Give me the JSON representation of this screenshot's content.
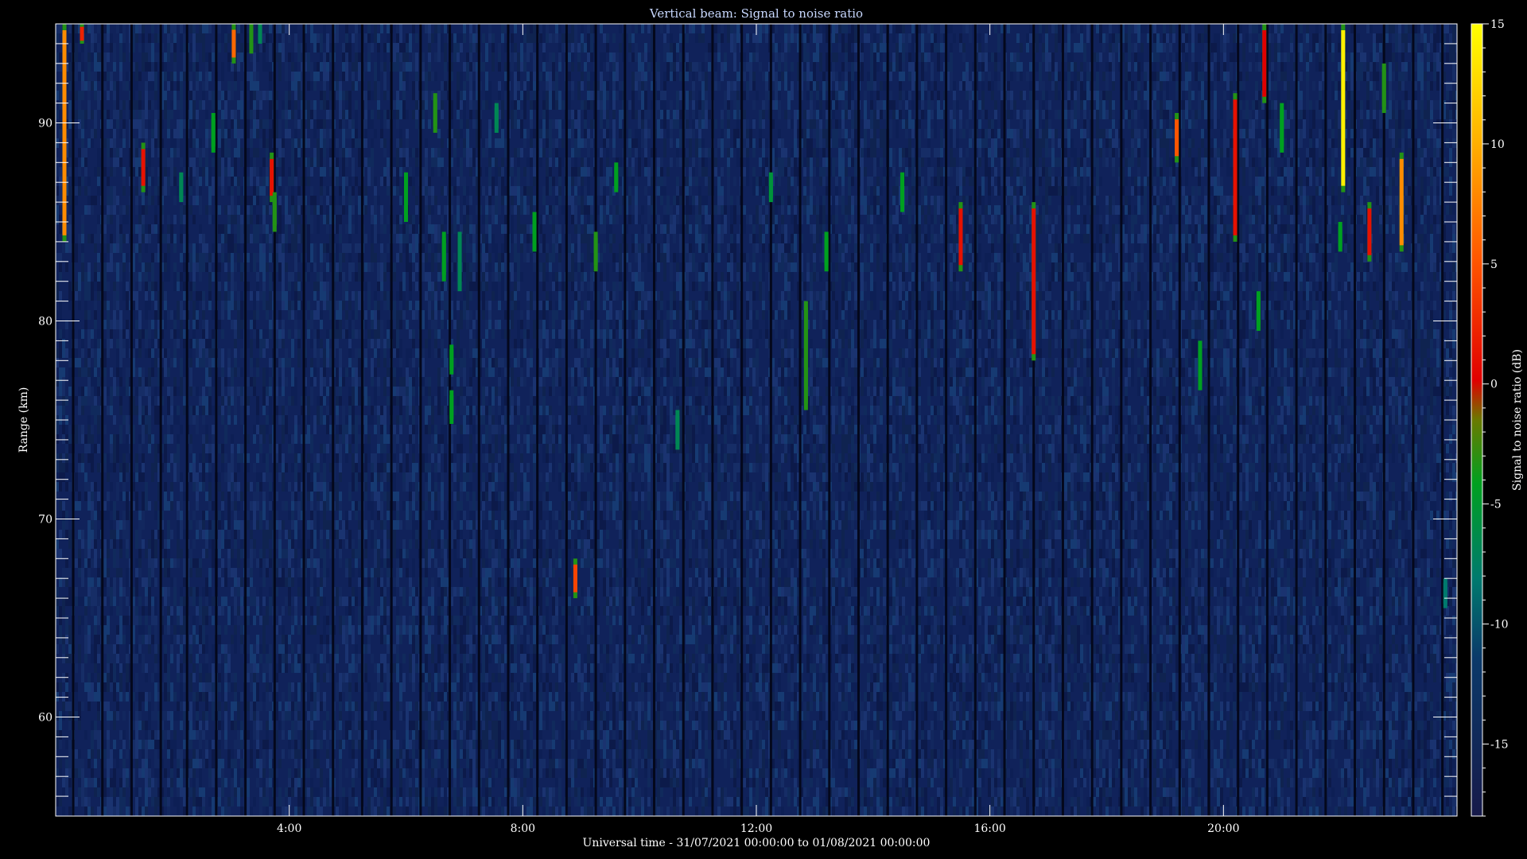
{
  "chart_data": {
    "type": "heatmap",
    "title": "Vertical beam: Signal to noise ratio",
    "xlabel": "Universal time - 31/07/2021 00:00:00 to 01/08/2021 00:00:00",
    "ylabel": "Range (km)",
    "colorbar_label": "Signal to noise ratio (dB)",
    "x_range_hours": [
      0,
      24
    ],
    "y_range_km": [
      55,
      95
    ],
    "color_range_db": [
      -18,
      15
    ],
    "x_ticks": [
      {
        "value": 4,
        "label": "4:00"
      },
      {
        "value": 8,
        "label": "8:00"
      },
      {
        "value": 12,
        "label": "12:00"
      },
      {
        "value": 16,
        "label": "16:00"
      },
      {
        "value": 20,
        "label": "20:00"
      }
    ],
    "y_ticks": [
      {
        "value": 60,
        "label": "60"
      },
      {
        "value": 70,
        "label": "70"
      },
      {
        "value": 80,
        "label": "80"
      },
      {
        "value": 90,
        "label": "90"
      }
    ],
    "colorbar_ticks": [
      {
        "value": 15,
        "label": "15"
      },
      {
        "value": 10,
        "label": "10"
      },
      {
        "value": 5,
        "label": "5"
      },
      {
        "value": 0,
        "label": "0"
      },
      {
        "value": -5,
        "label": "-5"
      },
      {
        "value": -10,
        "label": "-10"
      },
      {
        "value": -15,
        "label": "-15"
      }
    ],
    "background_level_db": -15,
    "data_gap_times_hours": [
      0.3,
      0.8,
      1.3,
      1.8,
      2.25,
      2.75,
      3.25,
      3.75,
      4.25,
      4.75,
      5.25,
      5.75,
      6.25,
      6.75,
      7.25,
      7.75,
      8.25,
      8.75,
      9.25,
      9.75,
      10.25,
      10.75,
      11.25,
      11.75,
      12.25,
      12.75,
      13.25,
      13.75,
      14.25,
      14.75,
      15.25,
      15.75,
      16.25,
      16.75,
      17.25,
      17.75,
      18.25,
      18.75,
      19.25,
      19.75,
      20.25,
      20.75,
      21.25,
      21.75,
      22.25,
      22.75,
      23.25,
      23.75
    ],
    "echoes": [
      {
        "t": 0.15,
        "r_top": 95,
        "r_bottom": 84,
        "snr_db": 8
      },
      {
        "t": 0.45,
        "r_top": 95,
        "r_bottom": 94,
        "snr_db": 2
      },
      {
        "t": 1.5,
        "r_top": 89,
        "r_bottom": 86.5,
        "snr_db": 1
      },
      {
        "t": 2.15,
        "r_top": 87.5,
        "r_bottom": 86,
        "snr_db": -8
      },
      {
        "t": 2.7,
        "r_top": 90.5,
        "r_bottom": 88.5,
        "snr_db": -6
      },
      {
        "t": 3.05,
        "r_top": 95,
        "r_bottom": 93,
        "snr_db": 6
      },
      {
        "t": 3.35,
        "r_top": 95,
        "r_bottom": 93.5,
        "snr_db": -5
      },
      {
        "t": 3.5,
        "r_top": 95,
        "r_bottom": 94,
        "snr_db": -8
      },
      {
        "t": 3.7,
        "r_top": 88.5,
        "r_bottom": 86,
        "snr_db": 1
      },
      {
        "t": 3.75,
        "r_top": 86.5,
        "r_bottom": 84.5,
        "snr_db": -5
      },
      {
        "t": 6.0,
        "r_top": 87.5,
        "r_bottom": 85,
        "snr_db": -6
      },
      {
        "t": 6.5,
        "r_top": 91.5,
        "r_bottom": 89.5,
        "snr_db": -5
      },
      {
        "t": 6.65,
        "r_top": 84.5,
        "r_bottom": 82,
        "snr_db": -6
      },
      {
        "t": 6.78,
        "r_top": 78.8,
        "r_bottom": 77.3,
        "snr_db": -6
      },
      {
        "t": 6.78,
        "r_top": 76.5,
        "r_bottom": 74.8,
        "snr_db": -6
      },
      {
        "t": 6.92,
        "r_top": 84.5,
        "r_bottom": 81.5,
        "snr_db": -8
      },
      {
        "t": 7.55,
        "r_top": 91,
        "r_bottom": 89.5,
        "snr_db": -8
      },
      {
        "t": 8.2,
        "r_top": 85.5,
        "r_bottom": 83.5,
        "snr_db": -6
      },
      {
        "t": 8.9,
        "r_top": 68,
        "r_bottom": 66,
        "snr_db": 4
      },
      {
        "t": 9.25,
        "r_top": 84.5,
        "r_bottom": 82.5,
        "snr_db": -5
      },
      {
        "t": 9.6,
        "r_top": 88,
        "r_bottom": 86.5,
        "snr_db": -6
      },
      {
        "t": 10.65,
        "r_top": 75.5,
        "r_bottom": 73.5,
        "snr_db": -8
      },
      {
        "t": 12.25,
        "r_top": 87.5,
        "r_bottom": 86,
        "snr_db": -7
      },
      {
        "t": 12.85,
        "r_top": 81,
        "r_bottom": 75.5,
        "snr_db": -5
      },
      {
        "t": 13.2,
        "r_top": 84.5,
        "r_bottom": 82.5,
        "snr_db": -6
      },
      {
        "t": 14.5,
        "r_top": 87.5,
        "r_bottom": 85.5,
        "snr_db": -6
      },
      {
        "t": 15.5,
        "r_top": 86,
        "r_bottom": 82.5,
        "snr_db": 1
      },
      {
        "t": 16.75,
        "r_top": 86,
        "r_bottom": 78,
        "snr_db": 1
      },
      {
        "t": 19.2,
        "r_top": 90.5,
        "r_bottom": 88,
        "snr_db": 5
      },
      {
        "t": 19.6,
        "r_top": 79,
        "r_bottom": 76.5,
        "snr_db": -6
      },
      {
        "t": 20.2,
        "r_top": 91.5,
        "r_bottom": 84,
        "snr_db": 1
      },
      {
        "t": 20.7,
        "r_top": 95,
        "r_bottom": 91,
        "snr_db": 0
      },
      {
        "t": 20.6,
        "r_top": 81.5,
        "r_bottom": 79.5,
        "snr_db": -6
      },
      {
        "t": 21.0,
        "r_top": 91,
        "r_bottom": 88.5,
        "snr_db": -6
      },
      {
        "t": 22.05,
        "r_top": 95,
        "r_bottom": 86.5,
        "snr_db": 14
      },
      {
        "t": 22.0,
        "r_top": 85,
        "r_bottom": 83.5,
        "snr_db": -6
      },
      {
        "t": 22.5,
        "r_top": 86,
        "r_bottom": 83,
        "snr_db": 1
      },
      {
        "t": 22.75,
        "r_top": 93,
        "r_bottom": 90.5,
        "snr_db": -5
      },
      {
        "t": 23.05,
        "r_top": 88.5,
        "r_bottom": 83.5,
        "snr_db": 8
      },
      {
        "t": 23.8,
        "r_top": 67,
        "r_bottom": 65.5,
        "snr_db": -9
      }
    ]
  }
}
